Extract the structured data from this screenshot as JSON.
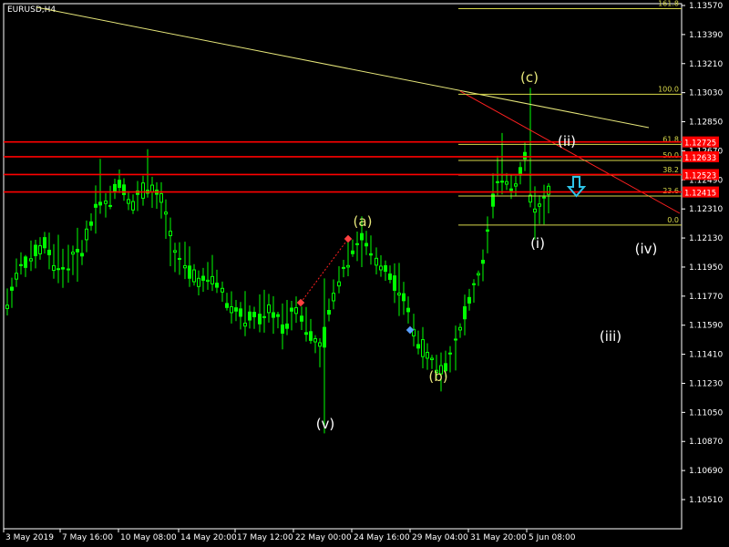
{
  "window": {
    "symbol_label": "EURUSD,H4"
  },
  "colors": {
    "background": "#000000",
    "candle": "#00ff00",
    "axis": "#ffffff",
    "grid_text": "#ffffff",
    "fib": "#d8d84a",
    "red_line": "#ff0000",
    "trend_yellow": "#e6e67a",
    "trend_red": "#ff2020",
    "wave_yellow": "#e6e67a",
    "wave_white": "#ffffff",
    "arrow_cyan": "#2ec4e8"
  },
  "chart_data": {
    "type": "candlestick",
    "price_axis": {
      "min": 1.1051,
      "max": 1.1357,
      "ticks": [
        "1.13570",
        "1.13390",
        "1.13210",
        "1.13030",
        "1.12850",
        "1.12670",
        "1.12490",
        "1.12310",
        "1.12130",
        "1.11950",
        "1.11770",
        "1.11590",
        "1.11410",
        "1.11230",
        "1.11050",
        "1.10870",
        "1.10690",
        "1.10510"
      ]
    },
    "time_axis": {
      "labels": [
        "3 May 2019",
        "7 May 16:00",
        "10 May 08:00",
        "14 May 20:00",
        "17 May 12:00",
        "22 May 00:00",
        "24 May 16:00",
        "29 May 04:00",
        "31 May 20:00",
        "5 Jun 08:00"
      ]
    },
    "candles_count": 117,
    "fib_levels": [
      {
        "label": "161.8",
        "price": 1.1355
      },
      {
        "label": "100.0",
        "price": 1.1302
      },
      {
        "label": "61.8",
        "price": 1.1271
      },
      {
        "label": "50.0",
        "price": 1.1261
      },
      {
        "label": "38.2",
        "price": 1.1252
      },
      {
        "label": "23.6",
        "price": 1.1239
      },
      {
        "label": "0.0",
        "price": 1.1221
      }
    ],
    "horizontal_levels": [
      {
        "label": "1.12725",
        "price": 1.12725
      },
      {
        "label": "1.12633",
        "price": 1.12633
      },
      {
        "label": "1.12523",
        "price": 1.12523
      },
      {
        "label": "1.12415",
        "price": 1.12415
      }
    ],
    "wave_labels": [
      {
        "text": "(v)",
        "color": "white"
      },
      {
        "text": "(a)",
        "color": "yellow"
      },
      {
        "text": "(b)",
        "color": "yellow"
      },
      {
        "text": "(c)",
        "color": "yellow"
      },
      {
        "text": "(i)",
        "color": "white"
      },
      {
        "text": "(ii)",
        "color": "white"
      },
      {
        "text": "(iii)",
        "color": "white"
      },
      {
        "text": "(iv)",
        "color": "white"
      }
    ]
  }
}
